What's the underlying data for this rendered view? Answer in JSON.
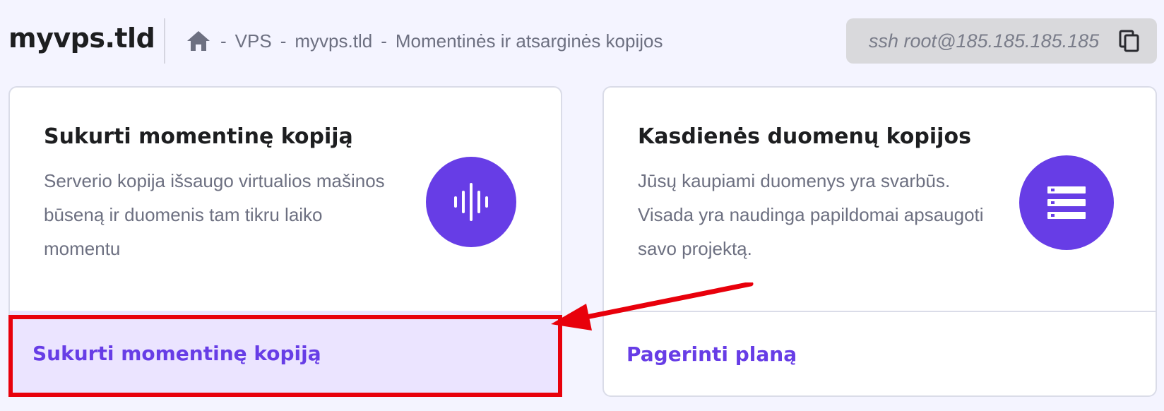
{
  "header": {
    "site_title": "myvps.tld",
    "breadcrumb": {
      "home_icon": "home-icon",
      "items": [
        {
          "sep": "-",
          "label": "VPS"
        },
        {
          "sep": "-",
          "label": "myvps.tld"
        },
        {
          "sep": "-",
          "label": "Momentinės ir atsarginės kopijos"
        }
      ]
    },
    "ssh": {
      "command": "ssh root@185.185.185.185",
      "copy_icon": "copy-icon"
    }
  },
  "cards": [
    {
      "title": "Sukurti momentinę kopiją",
      "description": "Serverio kopija išsaugo virtualios mašinos būseną ir duomenis tam tikru laiko momentu",
      "icon": "soundwave-icon",
      "action_label": "Sukurti momentinę kopiją"
    },
    {
      "title": "Kasdienės duomenų kopijos",
      "description": "Jūsų kaupiami duomenys yra svarbūs. Visada yra naudinga papildomai apsaugoti savo projektą.",
      "icon": "server-list-icon",
      "action_label": "Pagerinti planą"
    }
  ],
  "annotation": {
    "highlight_color": "#e8000b",
    "arrow_color": "#e8000b"
  },
  "colors": {
    "accent": "#673de6",
    "background": "#f4f4ff",
    "action_highlight_bg": "#ebe4ff"
  }
}
